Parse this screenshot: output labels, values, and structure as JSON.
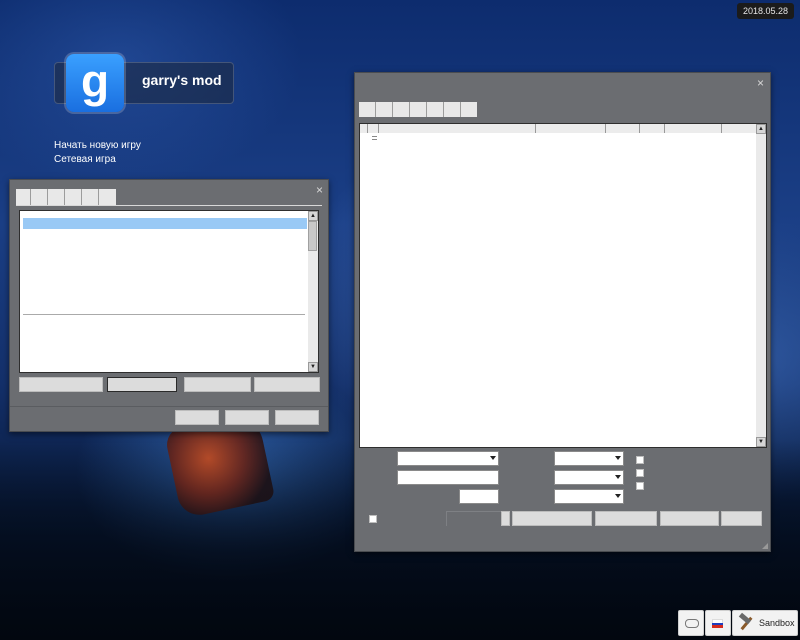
{
  "topbar": {
    "date": "2018.05.28"
  },
  "brand": {
    "logo_letter": "g",
    "title": "garry's mod"
  },
  "main_menu": {
    "items": [
      "Начать новую игру",
      "Сетевая игра"
    ]
  },
  "taskbar": {
    "gamepad_icon": "gamepad-icon",
    "language_icon": "russian-flag-icon",
    "gamemode_icon": "hammer-icon",
    "gamemode_label": "Sandbox"
  },
  "colors": {
    "selection": "#99c9f5",
    "window_bg": "#6b6d71",
    "accent_logo": "#1a6fe0"
  },
  "small_window": {
    "close_icon": "×",
    "tab_count": 6,
    "footer_button_count": 3,
    "action_button_count": 4
  },
  "large_window": {
    "close_icon": "×",
    "tab_count": 7,
    "header_col_count": 7
  }
}
